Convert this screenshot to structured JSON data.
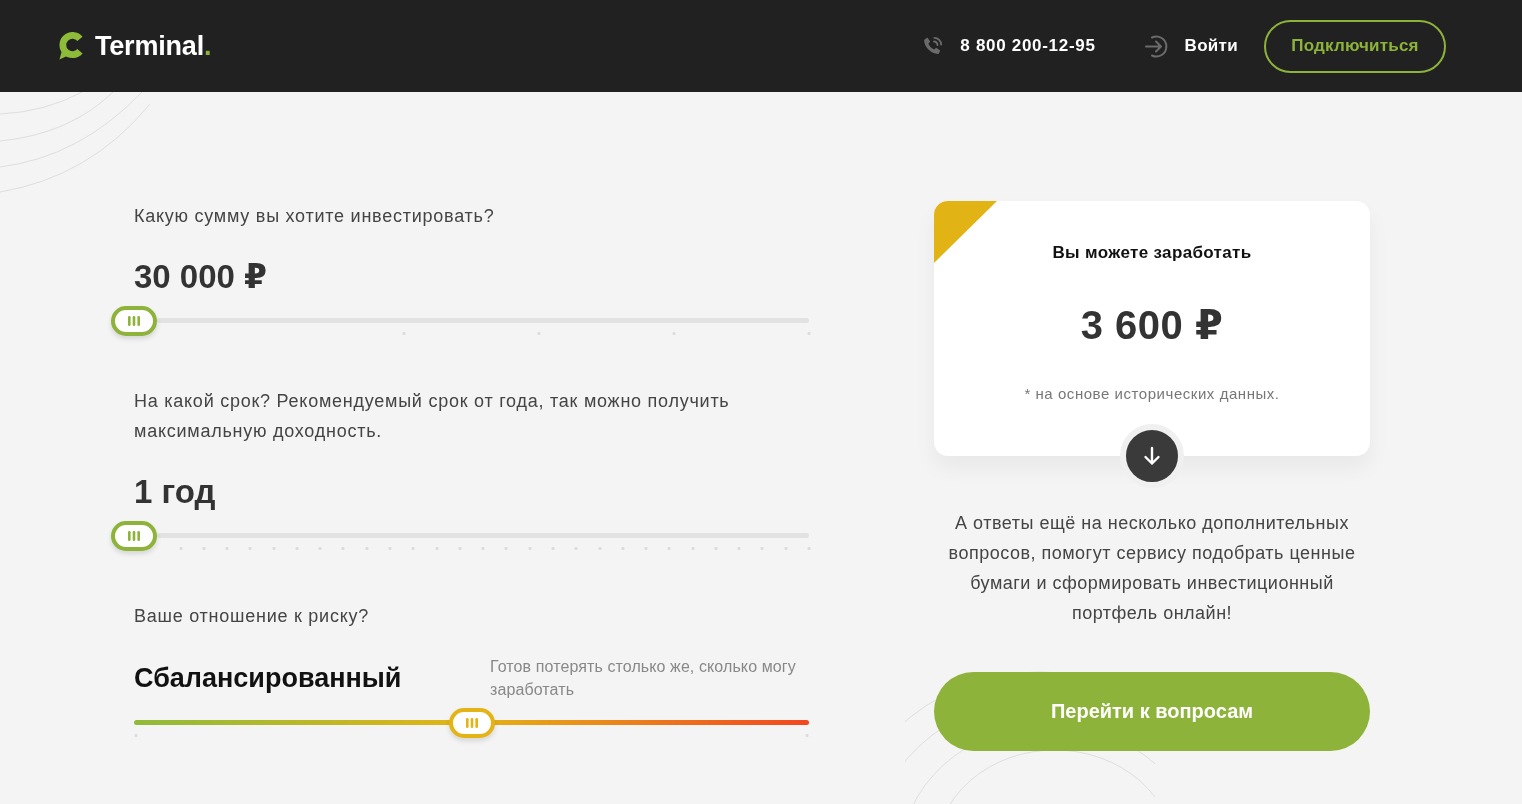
{
  "header": {
    "logo": {
      "text": "Terminal."
    },
    "phone": "8 800 200-12-95",
    "login": "Войти",
    "connect_button": "Подключиться"
  },
  "questions": [
    {
      "kind": "amount",
      "label": "Какую сумму вы хотите инвестировать?",
      "value": "30 000 ₽",
      "level": 0
    },
    {
      "kind": "term",
      "label": "На какой срок? Рекомендуемый срок от года, так можно получить максимальную доходность.",
      "value": "1 год",
      "level": 0
    },
    {
      "kind": "risk",
      "label": "Ваше отношение к риску?",
      "value": "Сбалансированный",
      "description": "Готов потерять столько же, сколько могу заработать",
      "level": 0.5
    }
  ],
  "result_card": {
    "title": "Вы можете заработать",
    "amount": "3 600 ₽",
    "note": "* на основе исторических данных."
  },
  "info_text": "А ответы ещё на несколько дополнительных вопросов, помогут сервису подобрать ценные бумаги и сформировать инвестиционный портфель онлайн!",
  "cta_button": "Перейти к вопросам"
}
